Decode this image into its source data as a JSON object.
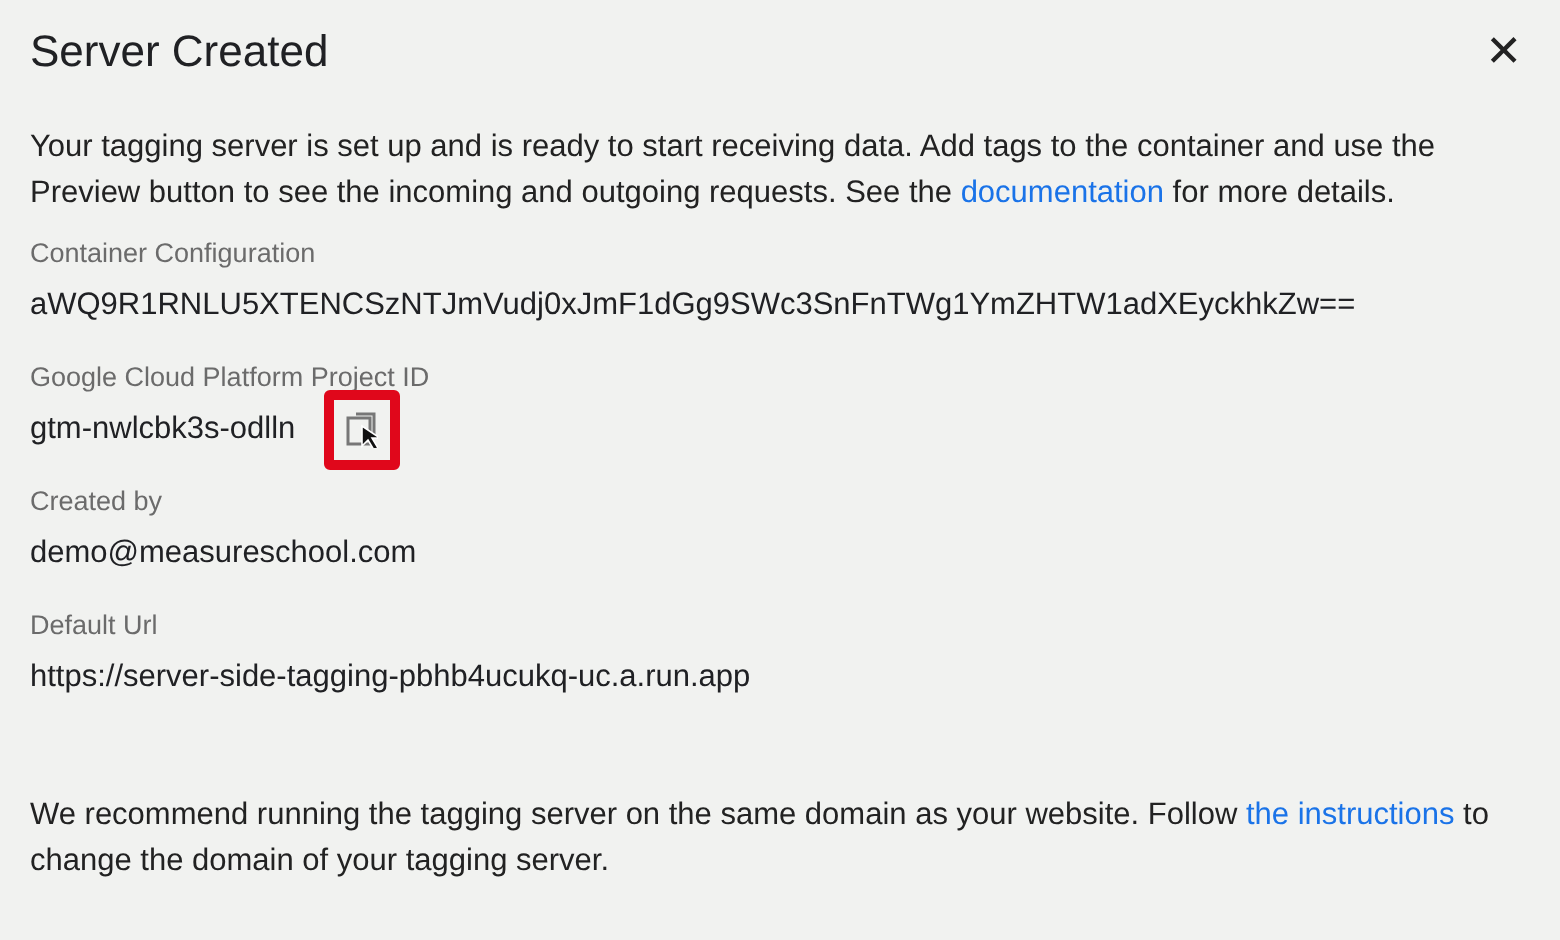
{
  "dialog": {
    "title": "Server Created",
    "close_icon": "✕"
  },
  "intro": {
    "before": "Your tagging server is set up and is ready to start receiving data. Add tags to the container and use the Preview button to see the incoming and outgoing requests. See the ",
    "link": "documentation",
    "after": " for more details."
  },
  "fields": [
    {
      "label": "Container Configuration",
      "value": "aWQ9R1RNLU5XTENCSzNTJmVudj0xJmF1dGg9SWc3SnFnTWg1YmZHTW1adXEyckhkZw=="
    },
    {
      "label": "Google Cloud Platform Project ID",
      "value": "gtm-nwlcbk3s-odlln",
      "copy_button": {
        "highlighted": true
      }
    },
    {
      "label": "Created by",
      "value": "demo@measureschool.com"
    },
    {
      "label": "Default Url",
      "value": "https://server-side-tagging-pbhb4ucukq-uc.a.run.app"
    }
  ],
  "note": {
    "before": "We recommend running the tagging server on the same domain as your website. Follow ",
    "link": "the instructions",
    "after": " to change the domain of your tagging server."
  }
}
